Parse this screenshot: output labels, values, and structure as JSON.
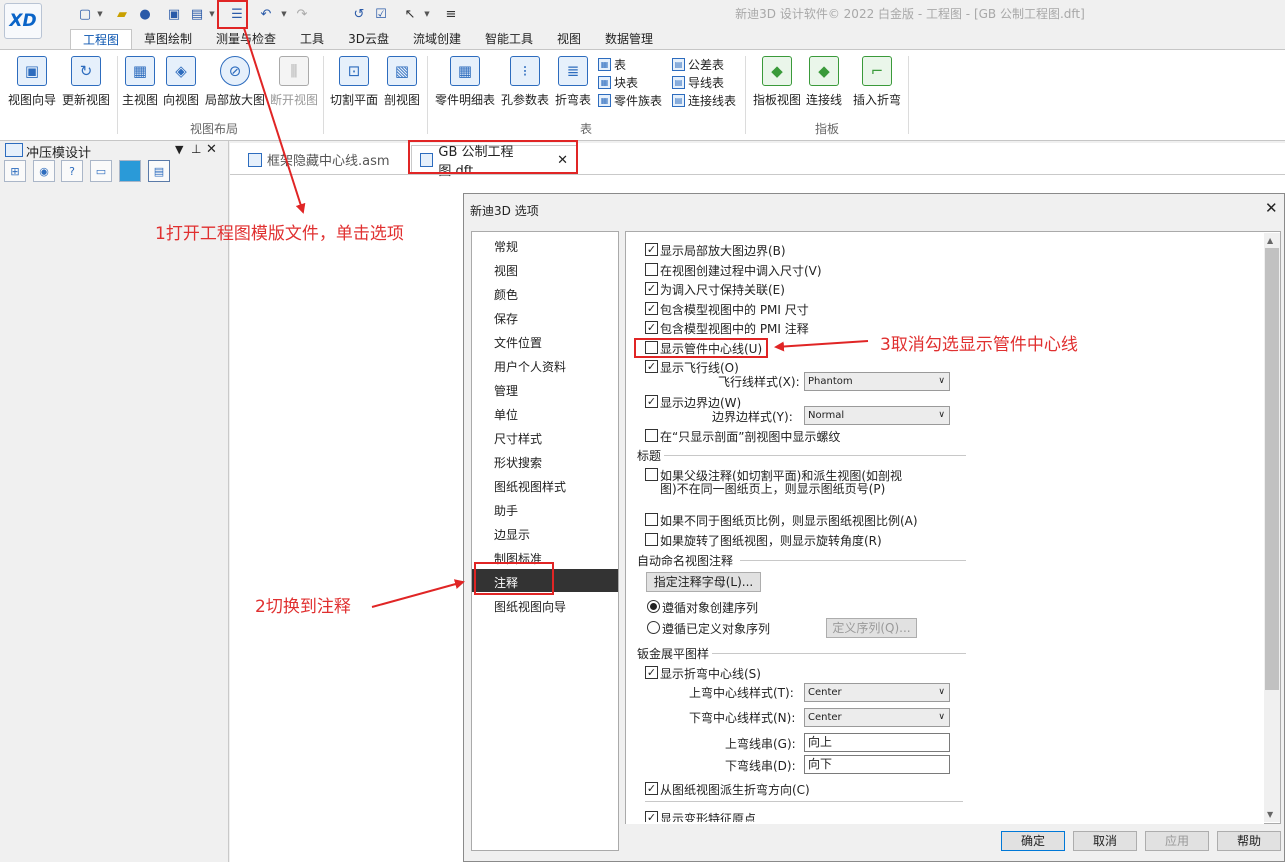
{
  "window": {
    "title": "新迪3D 设计软件© 2022 白金版 - 工程图 - [GB 公制工程图.dft]",
    "logo": "XD"
  },
  "qat": {
    "icons": [
      "new-file-icon",
      "open-file-icon",
      "save-icon",
      "save-all-icon",
      "options-icon",
      "undo-icon",
      "redo-icon",
      "select-icon",
      "customize-icon"
    ]
  },
  "ribbon_tabs": [
    "工程图",
    "草图绘制",
    "测量与检查",
    "工具",
    "3D云盘",
    "流域创建",
    "智能工具",
    "视图",
    "数据管理"
  ],
  "ribbon": {
    "view_layout": {
      "buttons": [
        "视图向导",
        "更新视图",
        "主视图",
        "向视图",
        "局部放大图",
        "断开视图",
        "切割平面",
        "剖视图"
      ],
      "group": "视图布局"
    },
    "table": {
      "buttons": [
        "零件明细表",
        "孔参数表",
        "折弯表"
      ],
      "small": [
        "表",
        "块表",
        "零件族表",
        "公差表",
        "导线表",
        "连接线表"
      ],
      "group": "表"
    },
    "pin_board": {
      "buttons": [
        "指板视图",
        "连接线",
        "插入折弯"
      ],
      "group": "指板"
    }
  },
  "left_panel": {
    "title": "冲压模设计"
  },
  "doc_tabs": [
    {
      "label": "框架隐藏中心线.asm"
    },
    {
      "label": "GB 公制工程图.dft",
      "close": "✕"
    }
  ],
  "dialog": {
    "title": "新迪3D 选项",
    "close": "✕",
    "nav": [
      "常规",
      "视图",
      "颜色",
      "保存",
      "文件位置",
      "用户个人资料",
      "管理",
      "单位",
      "尺寸样式",
      "形状搜索",
      "图纸视图样式",
      "助手",
      "边显示",
      "制图标准",
      "注释",
      "图纸视图向导"
    ],
    "selected_nav": "注释",
    "options": {
      "show_detail_border": {
        "label": "显示局部放大图边界(B)",
        "checked": true
      },
      "retrieve_dims": {
        "label": "在视图创建过程中调入尺寸(V)",
        "checked": false
      },
      "keep_assoc": {
        "label": "为调入尺寸保持关联(E)",
        "checked": true
      },
      "pmi_dim": {
        "label": "包含模型视图中的 PMI 尺寸",
        "checked": true
      },
      "pmi_ann": {
        "label": "包含模型视图中的 PMI 注释",
        "checked": true
      },
      "show_pipe_center": {
        "label": "显示管件中心线(U)",
        "checked": false
      },
      "show_flight": {
        "label": "显示飞行线(O)",
        "checked": true
      },
      "flight_style": {
        "label": "飞行线样式(X):",
        "value": "Phantom"
      },
      "show_boundary": {
        "label": "显示边界边(W)",
        "checked": true
      },
      "boundary_style": {
        "label": "边界边样式(Y):",
        "value": "Normal"
      },
      "show_thread": {
        "label": "在“只显示剖面”剖视图中显示螺纹",
        "checked": false
      }
    },
    "section_caption": {
      "title": "标题",
      "parent": {
        "line1": "如果父级注释(如切割平面)和派生视图(如剖视",
        "line2": "图)不在同一图纸页上，则显示图纸页号(P)",
        "checked": false
      },
      "scale": {
        "label": "如果不同于图纸页比例，则显示图纸视图比例(A)",
        "checked": false
      },
      "rotation": {
        "label": "如果旋转了图纸视图，则显示旋转角度(R)",
        "checked": false
      }
    },
    "section_auto": {
      "title": "自动命名视图注释",
      "letters_btn": "指定注释字母(L)...",
      "radio1": "遵循对象创建序列",
      "radio2": "遵循已定义对象序列",
      "define_btn": "定义序列(Q)..."
    },
    "section_flat": {
      "title": "钣金展平图样",
      "show_bend": {
        "label": "显示折弯中心线(S)",
        "checked": true
      },
      "up_style": {
        "label": "上弯中心线样式(T):",
        "value": "Center"
      },
      "down_style": {
        "label": "下弯中心线样式(N):",
        "value": "Center"
      },
      "up_string": {
        "label": "上弯线串(G):",
        "value": "向上"
      },
      "down_string": {
        "label": "下弯线串(D):",
        "value": "向下"
      },
      "derive": {
        "label": "从图纸视图派生折弯方向(C)",
        "checked": true
      },
      "deform": {
        "label": "显示变形特征原点",
        "checked": true
      }
    },
    "buttons": {
      "ok": "确定",
      "cancel": "取消",
      "apply": "应用",
      "help": "帮助"
    }
  },
  "annotations": {
    "step1": "1打开工程图模版文件，单击选项",
    "step2": "2切换到注释",
    "step3": "3取消勾选显示管件中心线"
  },
  "colors": {
    "accent": "#2d6cbe",
    "annotation": "#e02525",
    "selected_nav": "#333333"
  }
}
